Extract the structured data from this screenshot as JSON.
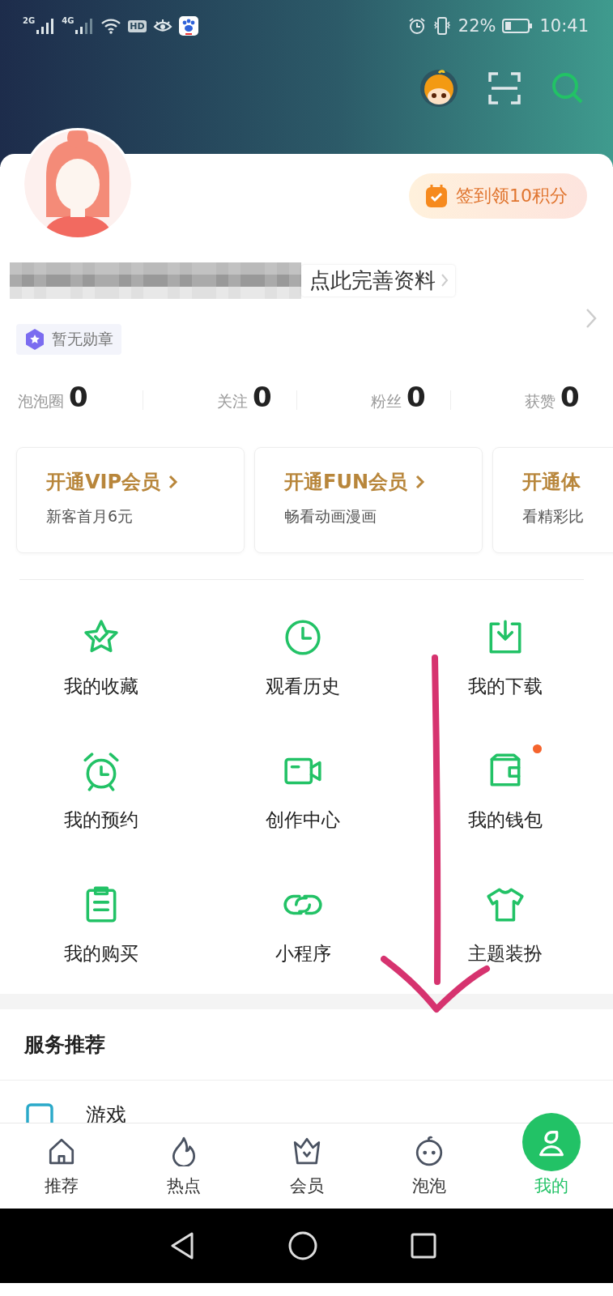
{
  "status_bar": {
    "network_1": "2G",
    "network_2": "4G",
    "hd_label": "HD",
    "battery_text": "22%",
    "time": "10:41"
  },
  "profile": {
    "checkin": "签到领10积分",
    "edit_link": "点此完善资料",
    "badge": "暂无勋章"
  },
  "stats": [
    {
      "label": "泡泡圈",
      "value": "0"
    },
    {
      "label": "关注",
      "value": "0"
    },
    {
      "label": "粉丝",
      "value": "0"
    },
    {
      "label": "获赞",
      "value": "0"
    }
  ],
  "membership_cards": [
    {
      "title": "开通VIP会员",
      "subtitle": "新客首月6元",
      "arrow": true
    },
    {
      "title": "开通FUN会员",
      "subtitle": "畅看动画漫画",
      "arrow": true
    },
    {
      "title": "开通体",
      "subtitle": "看精彩比",
      "arrow": false
    }
  ],
  "features": [
    {
      "label": "我的收藏",
      "dot": false
    },
    {
      "label": "观看历史",
      "dot": false
    },
    {
      "label": "我的下载",
      "dot": false
    },
    {
      "label": "我的预约",
      "dot": false
    },
    {
      "label": "创作中心",
      "dot": false
    },
    {
      "label": "我的钱包",
      "dot": true
    },
    {
      "label": "我的购买",
      "dot": false
    },
    {
      "label": "小程序",
      "dot": false
    },
    {
      "label": "主题装扮",
      "dot": false
    }
  ],
  "services": {
    "title": "服务推荐",
    "items": [
      {
        "label": "游戏"
      }
    ]
  },
  "tab_bar": [
    {
      "label": "推荐",
      "selected": false
    },
    {
      "label": "热点",
      "selected": false
    },
    {
      "label": "会员",
      "selected": false
    },
    {
      "label": "泡泡",
      "selected": false
    },
    {
      "label": "我的",
      "selected": true
    }
  ]
}
